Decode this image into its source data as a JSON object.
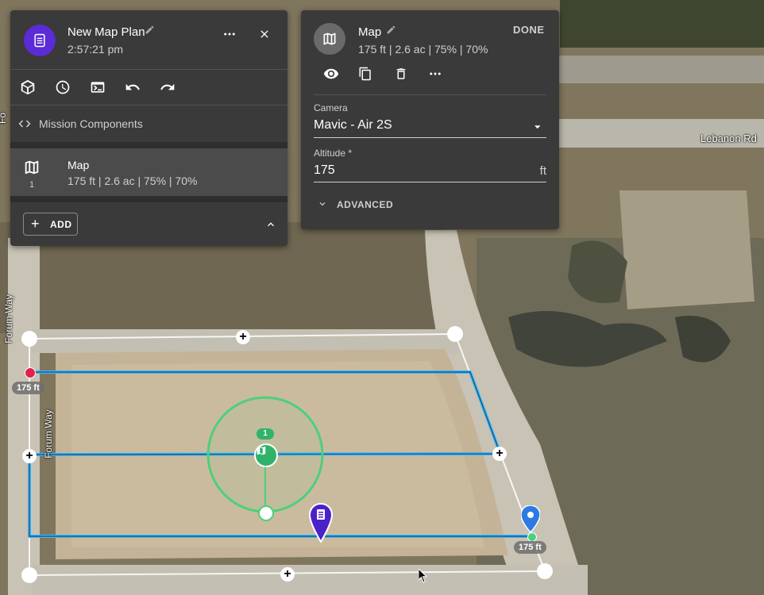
{
  "mission": {
    "title": "New Map Plan",
    "time": "2:57:21 pm",
    "section_label": "Mission Components",
    "add_label": "ADD",
    "component": {
      "name": "Map",
      "index": "1",
      "details": "175 ft | 2.6 ac | 75% | 70%"
    }
  },
  "editor": {
    "title": "Map",
    "details": "175 ft | 2.6 ac | 75% | 70%",
    "done_label": "DONE",
    "camera_label": "Camera",
    "camera_value": "Mavic - Air 2S",
    "altitude_label": "Altitude *",
    "altitude_value": "175",
    "altitude_unit": "ft",
    "advanced_label": "ADVANCED"
  },
  "map": {
    "roads": {
      "lebanon": "Lebanon Rd",
      "forum_way_1": "Forum Way",
      "forum_way_2": "Forum Way",
      "fo": "Fo"
    },
    "altitude_badge_left": "175 ft",
    "altitude_badge_right": "175 ft",
    "cluster_count": "1"
  },
  "colors": {
    "panel_bg": "#3a3a3a",
    "accent_purple": "#5b2bd6",
    "flight_line": "#38b6ff",
    "coverage": "#4cd07a",
    "start_marker": "#e0224a",
    "end_marker": "#2c7be5"
  }
}
